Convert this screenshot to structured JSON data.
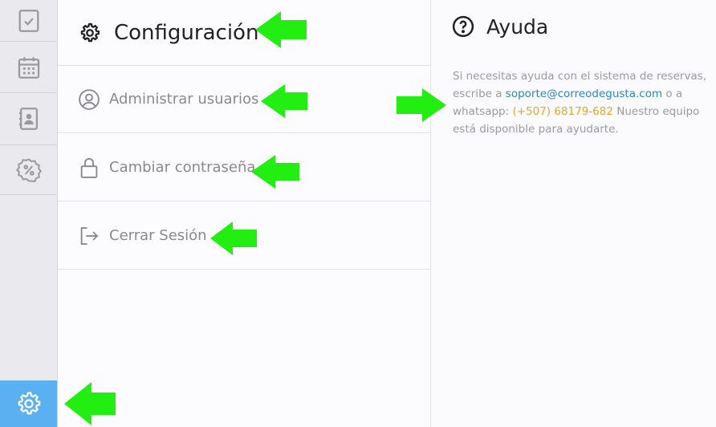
{
  "sidebar": {
    "items": [
      {
        "icon": "calendar-check-icon"
      },
      {
        "icon": "calendar-grid-icon"
      },
      {
        "icon": "contacts-book-icon"
      },
      {
        "icon": "percent-badge-icon"
      }
    ],
    "active": {
      "icon": "gear-icon"
    }
  },
  "settings": {
    "title": "Configuración",
    "items": [
      {
        "label": "Administrar usuarios",
        "icon": "user-circle-icon"
      },
      {
        "label": "Cambiar contraseña",
        "icon": "lock-icon"
      },
      {
        "label": "Cerrar Sesión",
        "icon": "logout-icon"
      }
    ]
  },
  "help": {
    "title": "Ayuda",
    "text_before": "Si necesitas ayuda con el sistema de reservas, escribe a ",
    "email": "soporte@correodegusta.com",
    "text_middle": " o a whatsapp: ",
    "phone": "(+507) 68179-682",
    "text_after": " Nuestro equipo está disponible para ayudarte."
  },
  "colors": {
    "sidebar_active": "#5ab0f1",
    "annotation_arrow": "#22ee11",
    "link": "#2e86c4",
    "phone": "#e6a82c"
  }
}
